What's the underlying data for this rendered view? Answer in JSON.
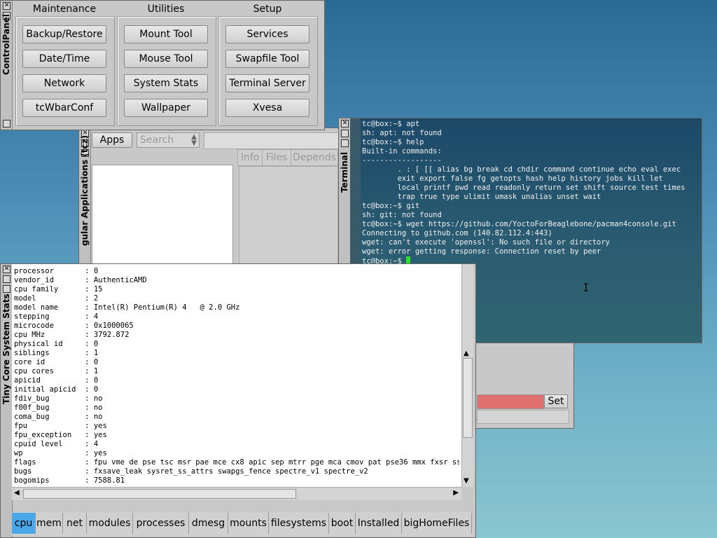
{
  "control_panel": {
    "title": "ControlPanel",
    "columns": [
      {
        "title": "Maintenance",
        "buttons": [
          "Backup/Restore",
          "Date/Time",
          "Network",
          "tcWbarConf"
        ]
      },
      {
        "title": "Utilities",
        "buttons": [
          "Mount Tool",
          "Mouse Tool",
          "System Stats",
          "Wallpaper"
        ]
      },
      {
        "title": "Setup",
        "buttons": [
          "Services",
          "Swapfile Tool",
          "Terminal Server",
          "Xvesa"
        ]
      }
    ]
  },
  "apps_window": {
    "title": "gular Applications (tcz)",
    "apps_button": "Apps",
    "search_placeholder": "Search",
    "tabs": [
      "Info",
      "Files",
      "Depends"
    ],
    "set_button": "Set"
  },
  "terminal": {
    "title": "Terminal",
    "lines": [
      "tc@box:~$ apt",
      "sh: apt: not found",
      "tc@box:~$ help",
      "Built-in commands:",
      "------------------",
      "        . : [ [[ alias bg break cd chdir command continue echo eval exec",
      "        exit export false fg getopts hash help history jobs kill let",
      "        local printf pwd read readonly return set shift source test times",
      "        trap true type ulimit umask unalias unset wait",
      "tc@box:~$ git",
      "sh: git: not found",
      "tc@box:~$ wget https://github.com/YoctoForBeaglebone/pacman4console.git",
      "Connecting to github.com (140.82.112.4:443)",
      "wget: can't execute 'openssl': No such file or directory",
      "wget: error getting response: Connection reset by peer"
    ],
    "prompt": "tc@box:~$ "
  },
  "system_stats": {
    "title": "Tiny Core System Stats",
    "rows": [
      [
        "processor",
        "0"
      ],
      [
        "vendor_id",
        "AuthenticAMD"
      ],
      [
        "cpu family",
        "15"
      ],
      [
        "model",
        "2"
      ],
      [
        "model name",
        "Intel(R) Pentium(R) 4   @ 2.0 GHz"
      ],
      [
        "stepping",
        "4"
      ],
      [
        "microcode",
        "0x1000065"
      ],
      [
        "cpu MHz",
        "3792.872"
      ],
      [
        "physical id",
        "0"
      ],
      [
        "siblings",
        "1"
      ],
      [
        "core id",
        "0"
      ],
      [
        "cpu cores",
        "1"
      ],
      [
        "apicid",
        "0"
      ],
      [
        "initial apicid",
        "0"
      ],
      [
        "fdiv_bug",
        "no"
      ],
      [
        "f00f_bug",
        "no"
      ],
      [
        "coma_bug",
        "no"
      ],
      [
        "fpu",
        "yes"
      ],
      [
        "fpu_exception",
        "yes"
      ],
      [
        "cpuid level",
        "4"
      ],
      [
        "wp",
        "yes"
      ],
      [
        "flags",
        "fpu vme de pse tsc msr pae mce cx8 apic sep mtrr pge mca cmov pat pse36 mmx fxsr sse sse"
      ],
      [
        "bugs",
        "fxsave_leak sysret_ss_attrs swapgs_fence spectre_v1 spectre_v2"
      ],
      [
        "bogomips",
        "7588.81"
      ]
    ],
    "tabs": [
      "cpu",
      "mem",
      "net",
      "modules",
      "processes",
      "dmesg",
      "mounts",
      "filesystems",
      "boot",
      "Installed",
      "bigHomeFiles"
    ],
    "active_tab": "cpu"
  },
  "colors": {
    "active_tab": "#4aa8e8",
    "cursor": "#2fe02f"
  }
}
